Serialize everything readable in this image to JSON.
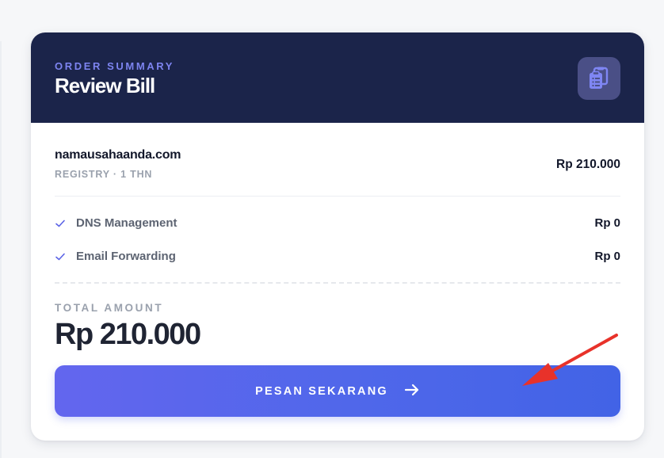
{
  "header": {
    "eyebrow": "ORDER SUMMARY",
    "title": "Review Bill",
    "icon": "clipboard-icon"
  },
  "domain": {
    "name": "namausahaanda.com",
    "meta": "REGISTRY · 1 THN",
    "price": "Rp 210.000"
  },
  "features": [
    {
      "label": "DNS Management",
      "price": "Rp 0",
      "icon": "check-icon"
    },
    {
      "label": "Email Forwarding",
      "price": "Rp 0",
      "icon": "check-icon"
    }
  ],
  "total": {
    "label": "TOTAL AMOUNT",
    "value": "Rp 210.000"
  },
  "cta": {
    "label": "PESAN SEKARANG",
    "icon": "arrow-right-icon"
  },
  "annotation": {
    "icon": "red-arrow-annotation",
    "color": "#e8322a"
  },
  "colors": {
    "header_bg": "#1b244a",
    "accent": "#7d84f0",
    "button_start": "#6366ee",
    "button_end": "#4263e6"
  }
}
